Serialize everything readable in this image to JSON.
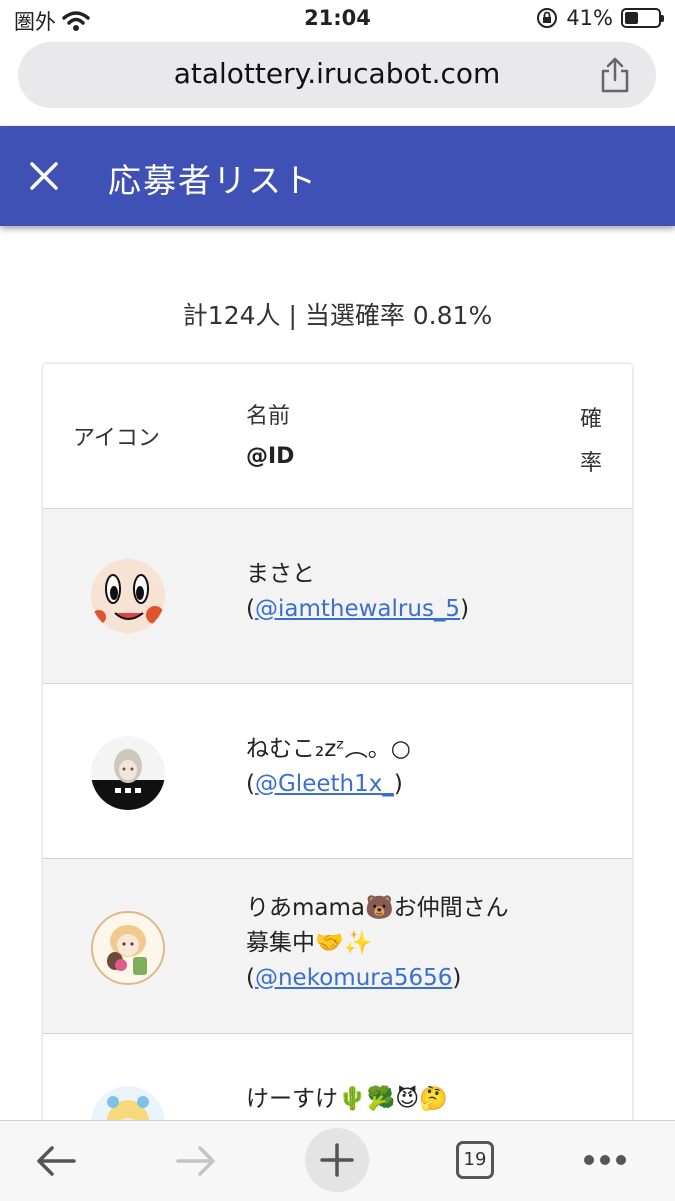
{
  "status": {
    "carrier": "圏外",
    "time": "21:04",
    "battery": "41%",
    "battery_level": 0.41
  },
  "browser": {
    "url": "atalottery.irucabot.com",
    "tab_count": "19"
  },
  "header": {
    "title": "応募者リスト"
  },
  "summary": "計124人 | 当選確率 0.81%",
  "table": {
    "headers": {
      "icon": "アイコン",
      "name": "名前",
      "id": "@ID",
      "probability": "確率"
    },
    "rows": [
      {
        "name": "まさと",
        "handle": "@iamthewalrus_5"
      },
      {
        "name": "ねむこ₂zᶻ︵。○",
        "handle": "@Gleeth1x_"
      },
      {
        "name": "りあmama🐻お仲間さん募集中🤝✨",
        "handle": "@nekomura5656"
      },
      {
        "name": "けーすけ🌵🥦😈🤔",
        "handle": ""
      }
    ]
  },
  "colors": {
    "appbar": "#3f51b5",
    "link": "#3a6fcf"
  }
}
